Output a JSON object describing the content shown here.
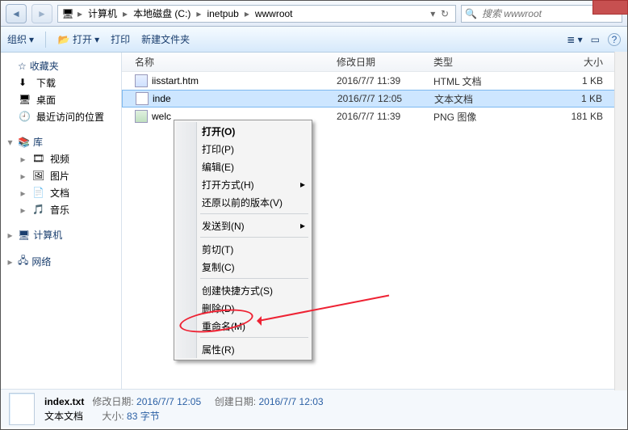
{
  "breadcrumb": [
    "计算机",
    "本地磁盘 (C:)",
    "inetpub",
    "wwwroot"
  ],
  "search_placeholder": "搜索 wwwroot",
  "toolbar": {
    "org": "组织",
    "open": "打开",
    "print": "打印",
    "newfolder": "新建文件夹"
  },
  "sidebar": {
    "fav": "收藏夹",
    "downloads": "下载",
    "desktop": "桌面",
    "recent": "最近访问的位置",
    "libs": "库",
    "video": "视频",
    "pictures": "图片",
    "docs": "文档",
    "music": "音乐",
    "computer": "计算机",
    "network": "网络"
  },
  "columns": {
    "name": "名称",
    "date": "修改日期",
    "type": "类型",
    "size": "大小"
  },
  "files": [
    {
      "name": "iisstart.htm",
      "date": "2016/7/7 11:39",
      "type": "HTML 文档",
      "size": "1 KB",
      "icon": "html"
    },
    {
      "name": "index.txt",
      "date": "2016/7/7 12:05",
      "type": "文本文档",
      "size": "1 KB",
      "icon": "txt",
      "selected": true,
      "display": "inde"
    },
    {
      "name": "welcome.png",
      "date": "2016/7/7 11:39",
      "type": "PNG 图像",
      "size": "181 KB",
      "icon": "png",
      "display": "welc"
    }
  ],
  "context_menu": [
    {
      "label": "打开(O)",
      "bold": true
    },
    {
      "label": "打印(P)"
    },
    {
      "label": "编辑(E)"
    },
    {
      "label": "打开方式(H)",
      "sub": true
    },
    {
      "label": "还原以前的版本(V)"
    },
    {
      "sep": true
    },
    {
      "label": "发送到(N)",
      "sub": true
    },
    {
      "sep": true
    },
    {
      "label": "剪切(T)"
    },
    {
      "label": "复制(C)"
    },
    {
      "sep": true
    },
    {
      "label": "创建快捷方式(S)"
    },
    {
      "label": "删除(D)"
    },
    {
      "label": "重命名(M)",
      "highlight": true
    },
    {
      "sep": true
    },
    {
      "label": "属性(R)"
    }
  ],
  "details": {
    "name": "index.txt",
    "type": "文本文档",
    "mod_label": "修改日期:",
    "mod_value": "2016/7/7 12:05",
    "size_label": "大小:",
    "size_value": "83 字节",
    "created_label": "创建日期:",
    "created_value": "2016/7/7 12:03"
  }
}
